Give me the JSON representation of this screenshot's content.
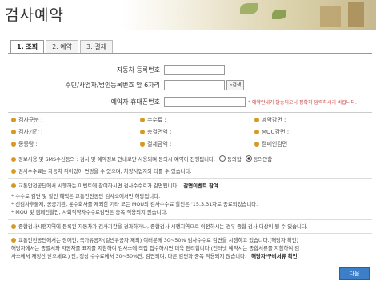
{
  "page": {
    "title": "검사예약"
  },
  "tabs": [
    {
      "label": "1. 조회"
    },
    {
      "label": "2. 예약"
    },
    {
      "label": "3. 결제"
    }
  ],
  "form": {
    "car_label": "자동차 등록번호",
    "id_label": "주민/사업자/법인등록번호 앞 6자리",
    "search_label": "검색",
    "phone_label": "예약자 휴대폰번호",
    "phone_note": "* 예약안내가 발송되오니 정확히 입력하시기 바랍니다."
  },
  "info": {
    "type_label": "검사구분 :",
    "fee_label": "수수료 :",
    "discount_label": "예약감면 :",
    "period_label": "검사기간 :",
    "total_label": "총결면액 :",
    "mou_label": "MOU감면 :",
    "car_kind_label": "종종량 :",
    "pay_label": "결제금액 :",
    "campaign_label": "캠페인감면 :"
  },
  "notes": {
    "sms": "정보사용 및 SMS수신동의 : 검사 및 예약정보 안내로만 사용되며 동의시 예약이 진행됩니다.",
    "agree": "동의함",
    "disagree": "동의안함",
    "n1": "검사수수료는 자동차 뒤어있어 변경을 수 있으며, 차량사업자와 다를 수 있습니다.",
    "n2": "교통안전공단에서 시행하는 이벤트에 참여하시면 검사수수료가 감면됩니다.",
    "n2b": "감면이벤트 참여",
    "n3": "* 수수료 감면 및 할인 혜택은 교통안전공단 검사소에서만 해당됩니다.",
    "n4": "* 선검사후불제, 공공기관, 운수회사를 제외한 기타 모든 MOU의 검사수수료 할인은 '15.3.31자로 종료되었습니다.",
    "n5": "* MOU 및 캠페인할인, 사회적약자수수료감면은 중복 적용되지 않습니다.",
    "n6": "종합검사시행지역에 등록된 자동차가 검사기간을 경과하거나, 종합검사 시행지역으로 이전하시는 경우 종합 검사 대상이 될 수 있습니다.",
    "n7": "교통안전공단에서는 장애인, 국가유공자(일반유공자 제외) 여러분께 30~50% 검사수수료 감면을 시행하고 있습니다.(해당자 확인)",
    "n8": "해당자에서는 종별서와 자동차를 표지를 지참하여 검사소에 직접 접수하시면 더욱 편리합니다.(인터넷 예약시는 종합서류를 지참하여 검",
    "n9": "사소에서 재정산 받으세요.) 단, 정상 수수료에서 30~50%만, 감면되며, 다른 감면과 중복 적용되지 않습니다.",
    "n9b": "해당자/구비서류 확인"
  },
  "next_button": "다음"
}
